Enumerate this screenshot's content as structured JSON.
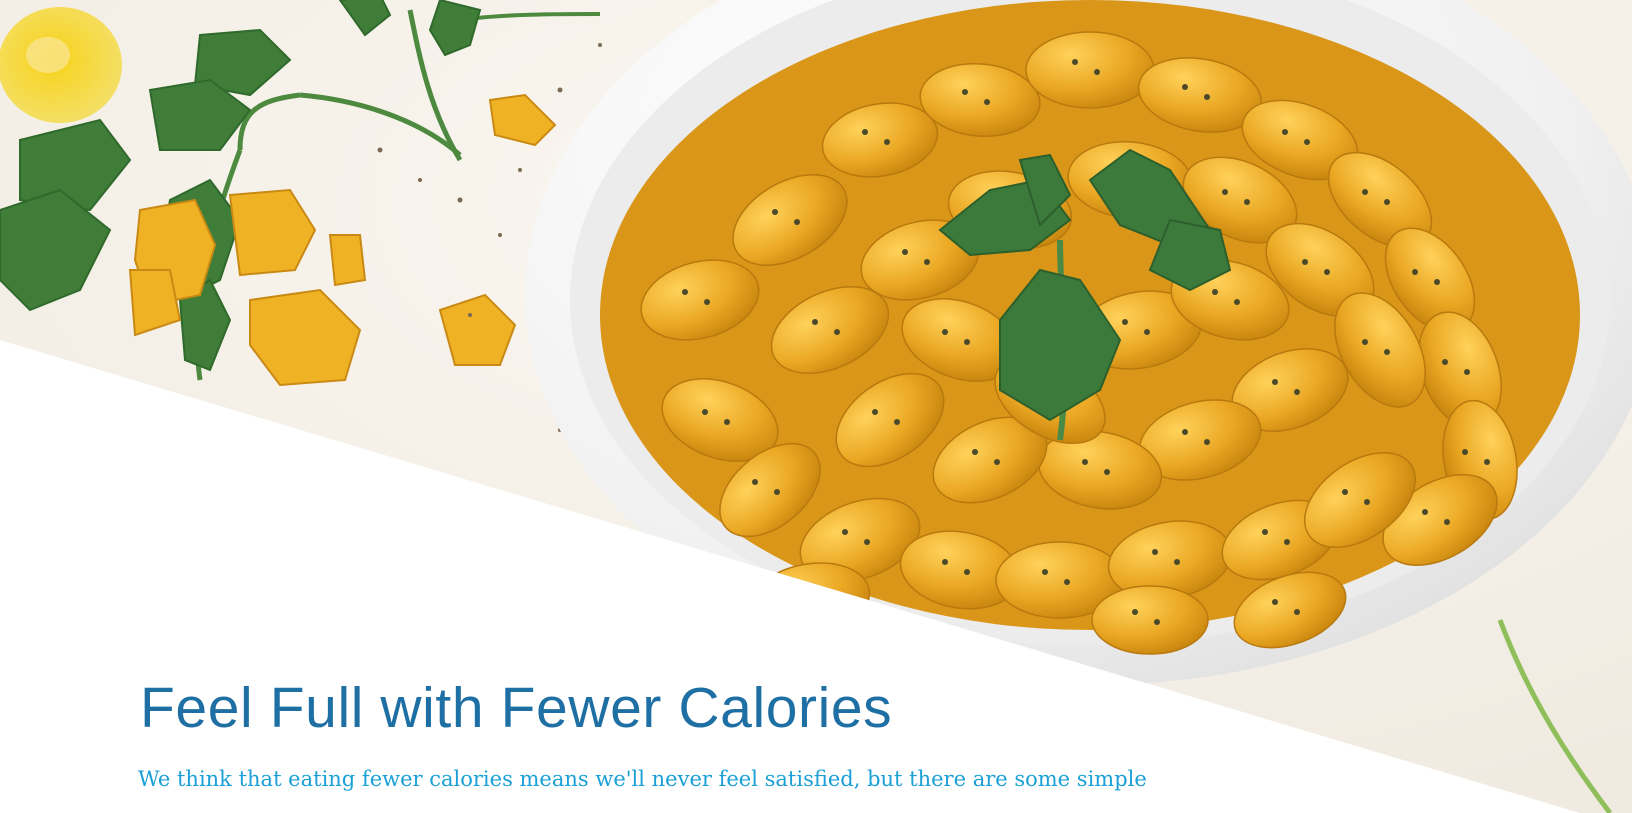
{
  "article": {
    "title": "Feel Full with Fewer Calories",
    "intro_line": "We think that eating fewer calories means we'll never feel satisfied, but there are some simple"
  },
  "colors": {
    "title": "#1e6fa3",
    "intro": "#1aa0d6",
    "beans": "#e6a41c",
    "parsley": "#3e7a3a",
    "bowl": "#f4f4f4"
  },
  "hero_image": {
    "subject": "bowl of seasoned butter beans garnished with parsley"
  }
}
